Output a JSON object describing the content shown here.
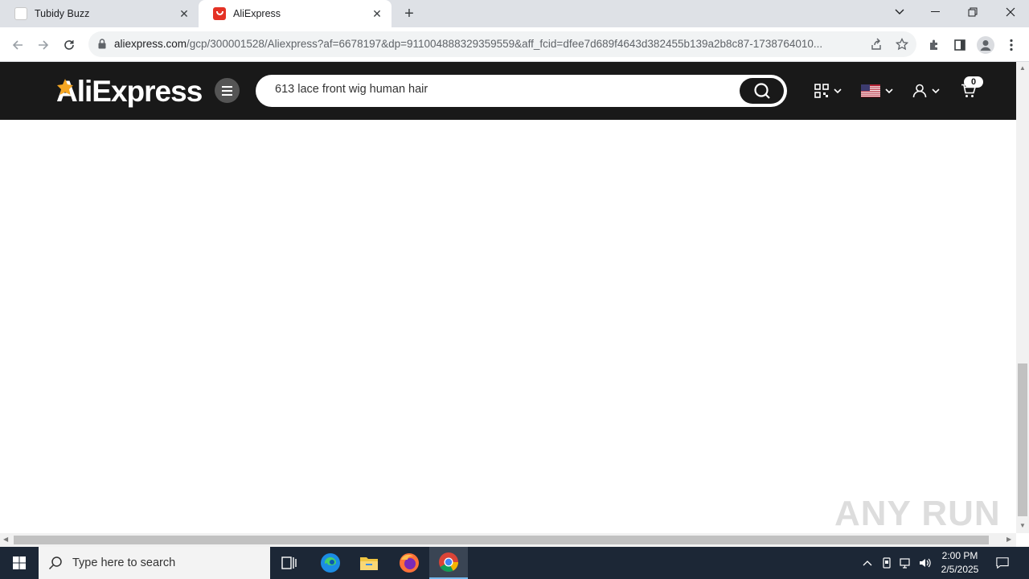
{
  "browser": {
    "tabs": [
      {
        "title": "Tubidy Buzz",
        "active": false
      },
      {
        "title": "AliExpress",
        "active": true
      }
    ],
    "url_host": "aliexpress.com",
    "url_rest": "/gcp/300001528/Aliexpress?af=6678197&dp=911004888329359559&aff_fcid=dfee7d689f4643d382455b139a2b8c87-1738764010..."
  },
  "site": {
    "logo": "AliExpress",
    "search_value": "613 lace front wig human hair",
    "cart_count": "0"
  },
  "watermark": "ANY RUN",
  "taskbar": {
    "search_placeholder": "Type here to search",
    "time": "2:00 PM",
    "date": "2/5/2025"
  },
  "colors": {
    "header_bg": "#191919",
    "tab_strip": "#dee1e6",
    "taskbar_bg": "#1c2736",
    "brand_star": "#f5a623"
  }
}
